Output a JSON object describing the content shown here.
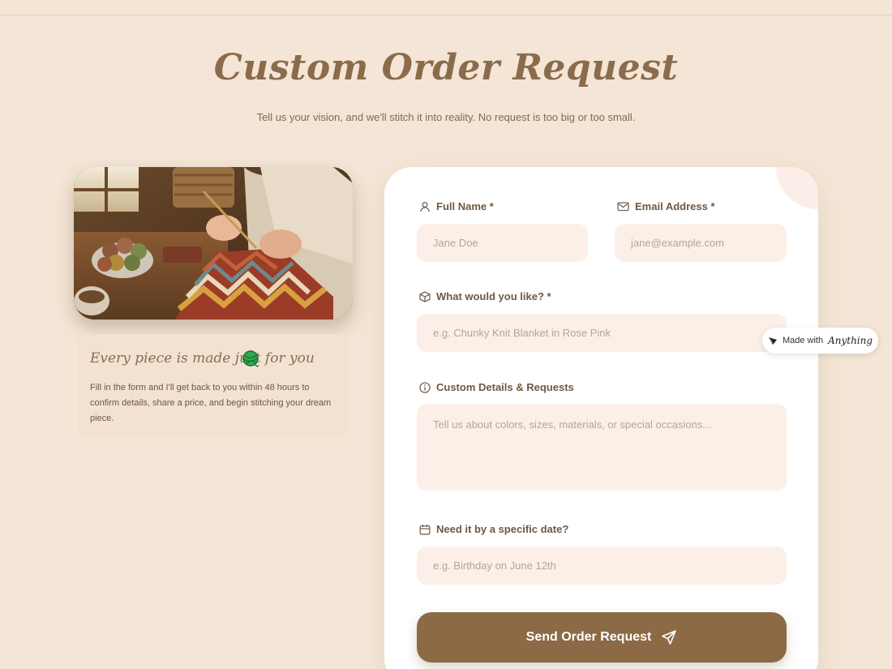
{
  "header": {
    "title": "Custom Order Request",
    "subtitle": "Tell us your vision, and we'll stitch it into reality. No request is too big or too small."
  },
  "intro": {
    "heading": "Every piece is made just for you",
    "body": "Fill in the form and I'll get back to you within 48 hours to confirm details, share a price, and begin stitching your dream piece.",
    "heading_icon": "yarn-ball-icon"
  },
  "form": {
    "full_name": {
      "label": "Full Name *",
      "placeholder": "Jane Doe",
      "value": "",
      "icon": "user-icon"
    },
    "email": {
      "label": "Email Address *",
      "placeholder": "jane@example.com",
      "value": "",
      "icon": "mail-icon"
    },
    "item": {
      "label": "What would you like? *",
      "placeholder": "e.g. Chunky Knit Blanket in Rose Pink",
      "value": "",
      "icon": "box-icon"
    },
    "details": {
      "label": "Custom Details & Requests",
      "placeholder": "Tell us about colors, sizes, materials, or special occasions...",
      "value": "",
      "icon": "info-icon"
    },
    "date": {
      "label": "Need it by a specific date?",
      "placeholder": "e.g. Birthday on June 12th",
      "value": "",
      "icon": "calendar-icon"
    },
    "submit_label": "Send Order Request",
    "submit_icon": "send-icon"
  },
  "badge": {
    "prefix": "Made with",
    "brand": "Anything"
  },
  "colors": {
    "background": "#f4e5d6",
    "accent": "#8b6a45",
    "field": "#fcefe8",
    "title": "#8a6c4c"
  }
}
